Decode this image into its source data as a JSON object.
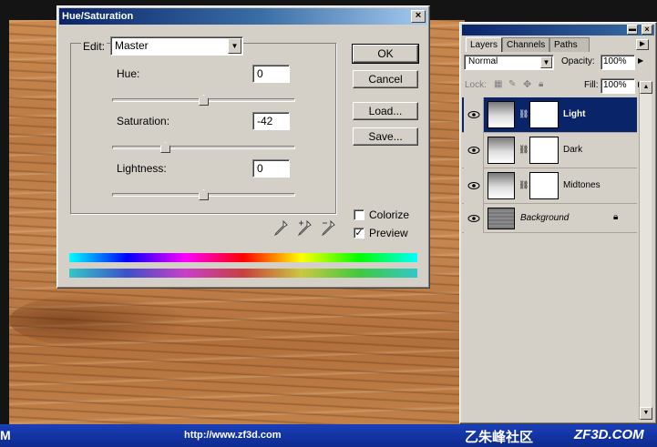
{
  "dialog": {
    "title": "Hue/Saturation",
    "close_glyph": "×",
    "edit_label": "Edit:",
    "edit_value": "Master",
    "hue_label": "Hue:",
    "hue_value": "0",
    "saturation_label": "Saturation:",
    "saturation_value": "-42",
    "lightness_label": "Lightness:",
    "lightness_value": "0",
    "buttons": {
      "ok": "OK",
      "cancel": "Cancel",
      "load": "Load...",
      "save": "Save..."
    },
    "colorize_label": "Colorize",
    "colorize_checked": false,
    "preview_label": "Preview",
    "preview_checked": true,
    "check_glyph": "✓"
  },
  "layers_panel": {
    "tabs": [
      "Layers",
      "Channels",
      "Paths"
    ],
    "active_tab": "Layers",
    "blend_mode": "Normal",
    "opacity_label": "Opacity:",
    "opacity_value": "100%",
    "lock_label": "Lock:",
    "fill_label": "Fill:",
    "fill_value": "100%",
    "layers": [
      {
        "name": "Light",
        "selected": true,
        "type": "adjustment"
      },
      {
        "name": "Dark",
        "selected": false,
        "type": "adjustment"
      },
      {
        "name": "Midtones",
        "selected": false,
        "type": "adjustment"
      },
      {
        "name": "Background",
        "selected": false,
        "type": "image",
        "locked": true
      }
    ]
  },
  "banner": {
    "left_text": "M",
    "url": "http://www.zf3d.com",
    "site_name_cn": "乙朱峰社区",
    "site_domain": "ZF3D.COM"
  },
  "colors": {
    "titlebar_start": "#0a246a",
    "titlebar_end": "#a6caf0",
    "selection": "#0a246a",
    "banner": "#1a3fb8",
    "panel_face": "#d4d0c8"
  },
  "icons": [
    "eyedropper-icon",
    "eyedropper-plus-icon",
    "eyedropper-minus-icon",
    "eye-icon",
    "chain-link-icon",
    "lock-icon",
    "close-icon"
  ]
}
